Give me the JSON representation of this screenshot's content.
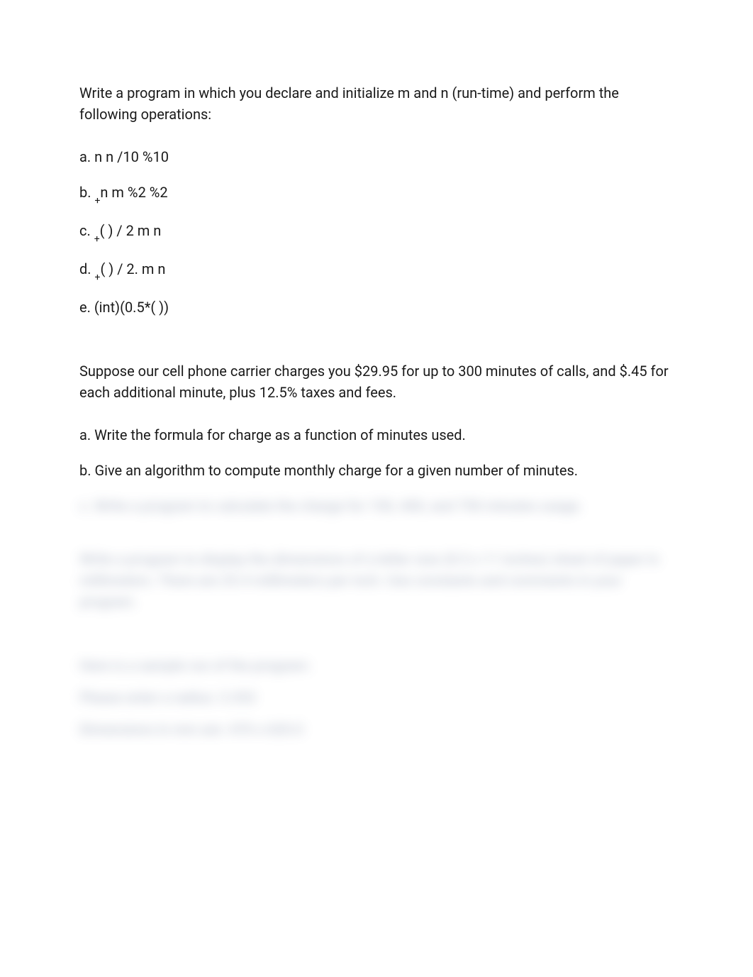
{
  "q1": {
    "prompt": "Write a program in which you declare and initialize m and n (run-time) and perform the following operations:",
    "items": {
      "a_pre": "a. n n /10 %10",
      "b_pre": "b. ",
      "b_post": "n m %2 %2",
      "b_sub": "+",
      "c_pre": "c. ",
      "c_post": "( ) / 2 m n",
      "c_sub": "+",
      "d_pre": "d. ",
      "d_post": "( ) / 2. m n",
      "d_sub": "+",
      "e": "e. (int)(0.5*( ))"
    }
  },
  "q2": {
    "prompt": "Suppose our cell phone carrier charges you $29.95 for up to 300 minutes of calls, and $.45 for each additional minute, plus 12.5% taxes and fees.",
    "items": {
      "a": "a. Write the formula for charge as a function of minutes used.",
      "b": "b. Give an algorithm to compute monthly charge for a given number of minutes."
    }
  },
  "blurred": {
    "line1": "c. Write a program to calculate the charge for 150, 400, and 750 minutes usage.",
    "line2": "Write a program to display the dimensions of a letter size (8.5 x 11 inches) sheet of paper in millimeters. There are 25.4 millimeters per inch. Use constants and comments in your program.",
    "line3": "Here is a sample run of the program:",
    "line4": "Please enter a radius: 3.353",
    "line5": "Dimensions in mm are: 470 x 620.0"
  }
}
